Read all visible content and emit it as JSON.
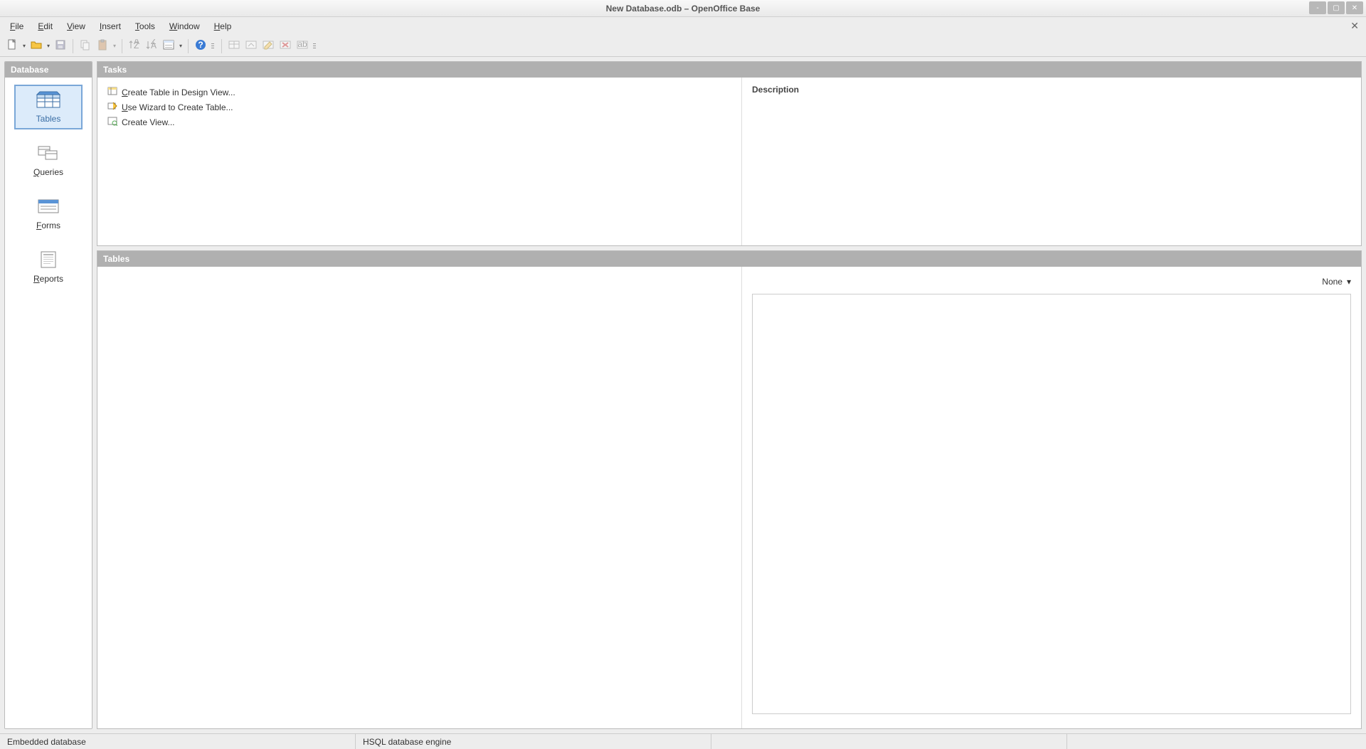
{
  "window": {
    "title": "New Database.odb – OpenOffice Base"
  },
  "menu": {
    "items": [
      {
        "key": "F",
        "rest": "ile"
      },
      {
        "key": "E",
        "rest": "dit"
      },
      {
        "key": "V",
        "rest": "iew"
      },
      {
        "key": "I",
        "rest": "nsert"
      },
      {
        "key": "T",
        "rest": "ools"
      },
      {
        "key": "W",
        "rest": "indow"
      },
      {
        "key": "H",
        "rest": "elp"
      }
    ]
  },
  "sidebar": {
    "header": "Database",
    "items": [
      {
        "label": "Tables",
        "selected": true,
        "icon": "tables-icon",
        "mn": ""
      },
      {
        "label": "ueries",
        "selected": false,
        "icon": "queries-icon",
        "mn": "Q"
      },
      {
        "label": "orms",
        "selected": false,
        "icon": "forms-icon",
        "mn": "F"
      },
      {
        "label": "eports",
        "selected": false,
        "icon": "reports-icon",
        "mn": "R"
      }
    ]
  },
  "tasks": {
    "header": "Tasks",
    "description_label": "Description",
    "items": [
      {
        "mn": "C",
        "rest": "reate Table in Design View...",
        "icon": "design-icon"
      },
      {
        "mn": "U",
        "rest": "se Wizard to Create Table...",
        "icon": "wizard-icon"
      },
      {
        "mn": "",
        "rest": "Create View...",
        "icon": "view-icon"
      }
    ]
  },
  "tables": {
    "header": "Tables",
    "view_mode": "None"
  },
  "status": {
    "left": "Embedded database",
    "engine": "HSQL database engine"
  }
}
